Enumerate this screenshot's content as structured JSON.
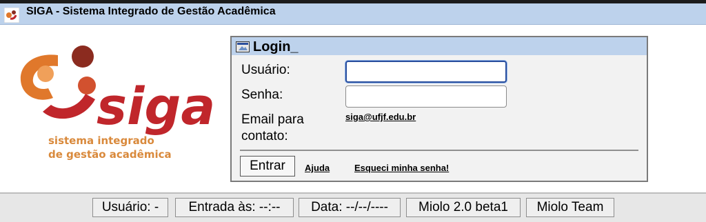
{
  "header": {
    "title": "SIGA - Sistema Integrado de Gestão Acadêmica",
    "icon": "siga-app-icon"
  },
  "logo": {
    "wordmark": "siga",
    "tagline_line1": "sistema integrado",
    "tagline_line2": "de gestão acadêmica",
    "colors": {
      "orange": "#e0782b",
      "red": "#c0262b",
      "brown": "#8b2b1f"
    }
  },
  "login": {
    "title": "Login_",
    "title_icon": "window-icon",
    "user_label": "Usuário:",
    "user_value": "",
    "password_label": "Senha:",
    "password_value": "",
    "email_label_line1": "Email para",
    "email_label_line2": "contato:",
    "email": "siga@ufjf.edu.br",
    "enter_button": "Entrar",
    "help_link": "Ajuda",
    "forgot_link": "Esqueci minha senha!"
  },
  "status_bar": {
    "user": "Usuário: -",
    "entry": "Entrada às: --:--",
    "date": "Data: --/--/----",
    "version": "Miolo 2.0 beta1",
    "team": "Miolo Team"
  },
  "colors": {
    "header_bg": "#bdd2ec",
    "panel_bg": "#f2f2f2",
    "focus_border": "#2a4f9e"
  }
}
